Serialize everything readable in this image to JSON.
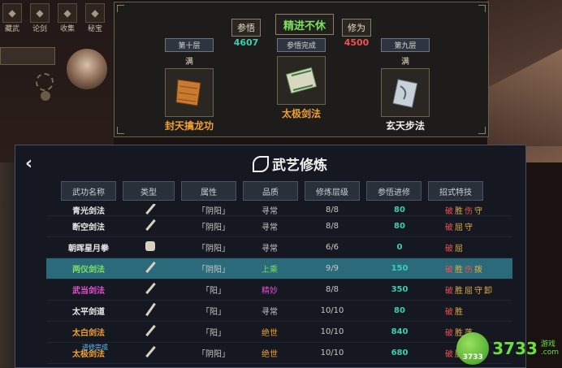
{
  "top_bar": {
    "icons": [
      {
        "label": "藏武",
        "icon": "weapon-rack-icon"
      },
      {
        "label": "论剑",
        "icon": "sword-icon"
      },
      {
        "label": "收集",
        "icon": "collection-icon"
      },
      {
        "label": "秘宝",
        "icon": "treasure-icon"
      }
    ]
  },
  "top_panel": {
    "insight": {
      "label": "参悟",
      "value": "4607"
    },
    "banner": "精进不休",
    "cultivation": {
      "label": "修为",
      "value": "4500"
    },
    "cards": [
      {
        "tag": "第十层",
        "status": "满",
        "name": "封天擒龙功",
        "name_color": "#f0a030"
      },
      {
        "tag": "参悟完成",
        "status": "",
        "name": "太极剑法",
        "name_color": "#f0a030"
      },
      {
        "tag": "第九层",
        "status": "满",
        "name": "玄天步法",
        "name_color": "#f0f0f0"
      }
    ]
  },
  "main_panel": {
    "title": "武艺修炼",
    "headers": [
      "武功名称",
      "类型",
      "属性",
      "品质",
      "修炼层级",
      "参悟进修",
      "招式特技"
    ],
    "rows": [
      {
        "name": "青光剑法",
        "name_color": "#e8e8e8",
        "type": "sword",
        "attr": "「阴阳」",
        "quality": "寻常",
        "quality_color": "#c8c8c8",
        "level": "8/8",
        "insight": "80",
        "features": [
          {
            "t": "破",
            "c": "r"
          },
          {
            "t": "胜",
            "c": "y"
          },
          {
            "t": "伤",
            "c": "r"
          },
          {
            "t": "守",
            "c": "y"
          }
        ],
        "partial": true
      },
      {
        "name": "断空剑法",
        "name_color": "#e8e8e8",
        "type": "sword",
        "attr": "「阴阳」",
        "quality": "寻常",
        "quality_color": "#c8c8c8",
        "level": "8/8",
        "insight": "80",
        "features": [
          {
            "t": "破",
            "c": "r"
          },
          {
            "t": "屈",
            "c": "y"
          },
          {
            "t": "守",
            "c": "y"
          }
        ]
      },
      {
        "name": "朝晖星月拳",
        "name_color": "#e8e8e8",
        "type": "fist",
        "attr": "「阴阳」",
        "quality": "寻常",
        "quality_color": "#c8c8c8",
        "level": "6/6",
        "insight": "0",
        "features": [
          {
            "t": "破",
            "c": "r"
          },
          {
            "t": "屈",
            "c": "y"
          }
        ]
      },
      {
        "name": "两仪剑法",
        "name_color": "#7ce060",
        "type": "sword",
        "attr": "「阴阳」",
        "quality": "上乘",
        "quality_color": "#7ce060",
        "level": "9/9",
        "insight": "150",
        "features": [
          {
            "t": "破",
            "c": "r"
          },
          {
            "t": "胜",
            "c": "y"
          },
          {
            "t": "伤",
            "c": "r"
          },
          {
            "t": "拨",
            "c": "y"
          }
        ],
        "selected": true
      },
      {
        "name": "武当剑法",
        "name_color": "#e050d0",
        "type": "sword",
        "attr": "「阳」",
        "quality": "精妙",
        "quality_color": "#e050d0",
        "level": "8/8",
        "insight": "350",
        "features": [
          {
            "t": "破",
            "c": "r"
          },
          {
            "t": "胜",
            "c": "y"
          },
          {
            "t": "屈",
            "c": "y"
          },
          {
            "t": "守",
            "c": "y"
          },
          {
            "t": "卸",
            "c": "y"
          }
        ]
      },
      {
        "name": "太平剑道",
        "name_color": "#e8e8e8",
        "type": "spear",
        "attr": "「阳」",
        "quality": "寻常",
        "quality_color": "#c8c8c8",
        "level": "10/10",
        "insight": "80",
        "features": [
          {
            "t": "破",
            "c": "r"
          },
          {
            "t": "胜",
            "c": "y"
          }
        ]
      },
      {
        "name": "太白剑法",
        "name_color": "#f0a030",
        "type": "sword",
        "attr": "「阳」",
        "quality": "绝世",
        "quality_color": "#f0a030",
        "level": "10/10",
        "insight": "840",
        "features": [
          {
            "t": "破",
            "c": "r"
          },
          {
            "t": "胜",
            "c": "y"
          },
          {
            "t": "落",
            "c": "y"
          }
        ]
      },
      {
        "name": "太极剑法",
        "name_color": "#f0a030",
        "type": "sword",
        "attr": "「阴阳」",
        "quality": "绝世",
        "quality_color": "#f0a030",
        "level": "10/10",
        "insight": "680",
        "features": [
          {
            "t": "破",
            "c": "r"
          },
          {
            "t": "胜",
            "c": "y"
          }
        ],
        "sub_label": "进修完成"
      }
    ]
  },
  "watermark": {
    "ball": "3733",
    "text": "3733",
    "small1": "游戏",
    "small2": ".com"
  }
}
